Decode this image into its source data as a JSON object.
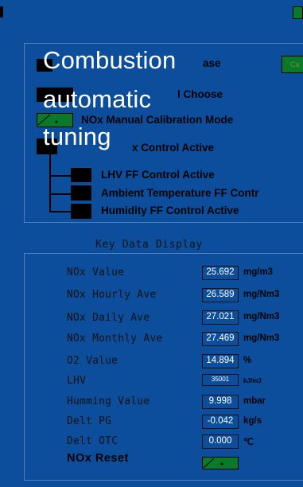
{
  "overlay": {
    "line1": "Combustion",
    "line2": "automatic",
    "line3": "tuning"
  },
  "controls": {
    "row1_label": "ase",
    "row1_side_button": "Ca",
    "row2_label": "l Choose",
    "row3_label": "NOx Manual Calibration Mode",
    "row4_label": "x Control Active",
    "sub_items": [
      "LHV FF Control Active",
      "Ambient Temperature FF Contr",
      "Humidity FF Control Active"
    ]
  },
  "key_data": {
    "title": "Key Data Display",
    "rows": [
      {
        "label": "NOx Value",
        "value": "25.692",
        "unit": "mg/m3"
      },
      {
        "label": "NOx Hourly Ave",
        "value": "26.589",
        "unit": "mg/Nm3"
      },
      {
        "label": "NOx Daily Ave",
        "value": "27.021",
        "unit": "mg/Nm3"
      },
      {
        "label": "NOx Monthly Ave",
        "value": "27.469",
        "unit": "mg/Nm3"
      },
      {
        "label": "O2 Value",
        "value": "14.894",
        "unit": "%"
      },
      {
        "label": "LHV",
        "value": "35001",
        "unit": "kJ/m3"
      },
      {
        "label": "Humming Value",
        "value": "9.998",
        "unit": "mbar"
      },
      {
        "label": "Delt PG",
        "value": "-0.042",
        "unit": "kg/s"
      },
      {
        "label": "Delt OTC",
        "value": "0.000",
        "unit": "℃"
      }
    ],
    "reset_label": "NOx Reset"
  },
  "colors": {
    "background": "#0d4e9c",
    "toggle_green": "#0a7a2a"
  }
}
